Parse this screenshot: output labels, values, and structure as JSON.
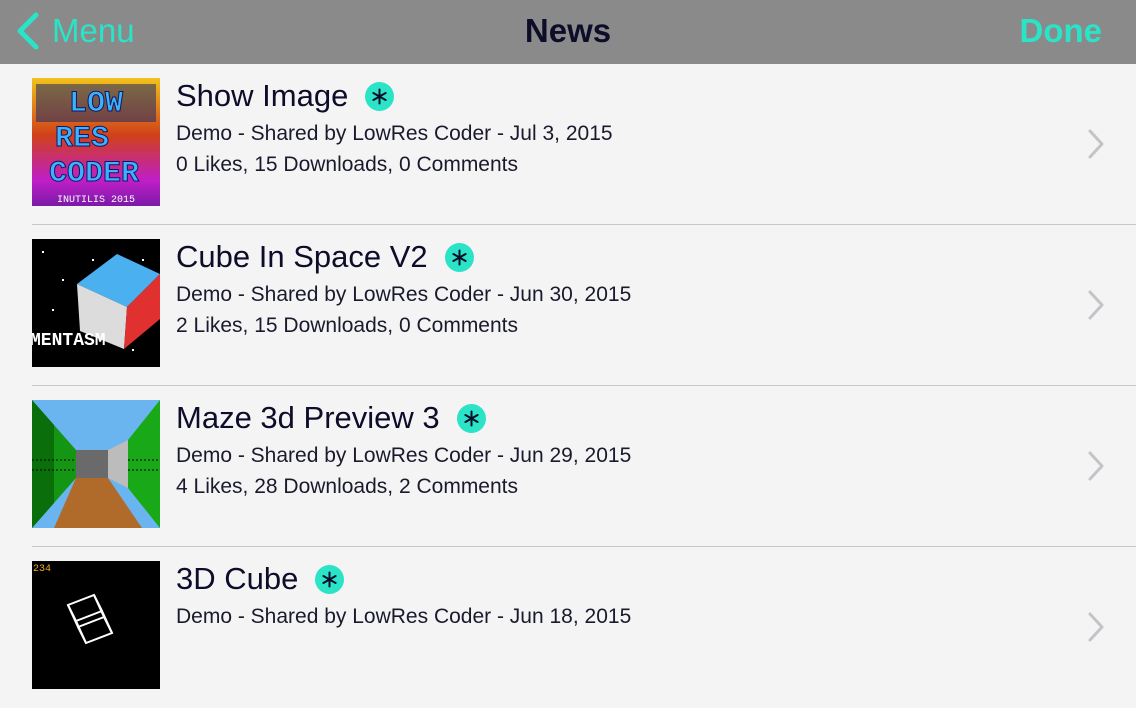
{
  "navbar": {
    "back_label": "Menu",
    "title": "News",
    "done_label": "Done"
  },
  "items": [
    {
      "name": "Show Image",
      "category": "Demo - Shared by LowRes Coder - Jul 3, 2015",
      "stats": "0 Likes, 15 Downloads, 0 Comments",
      "thumb_text": [
        "LOW",
        "RES",
        "CODER",
        "INUTILIS 2015"
      ]
    },
    {
      "name": "Cube In Space V2",
      "category": "Demo - Shared by LowRes Coder - Jun 30, 2015",
      "stats": "2 Likes, 15 Downloads, 0 Comments",
      "thumb_text": [
        "MENTASM"
      ]
    },
    {
      "name": "Maze 3d Preview 3",
      "category": "Demo - Shared by LowRes Coder - Jun 29, 2015",
      "stats": "4 Likes, 28 Downloads, 2 Comments"
    },
    {
      "name": "3D Cube",
      "category": "Demo - Shared by LowRes Coder - Jun 18, 2015",
      "thumb_text": [
        "234"
      ]
    }
  ],
  "colors": {
    "accent": "#2be3c6",
    "navbar": "#8a8a8a",
    "background": "#f4f4f4"
  },
  "icons": {
    "back": "chevron-left-icon",
    "badge": "asterisk-badge-icon",
    "disclosure": "chevron-right-icon"
  }
}
